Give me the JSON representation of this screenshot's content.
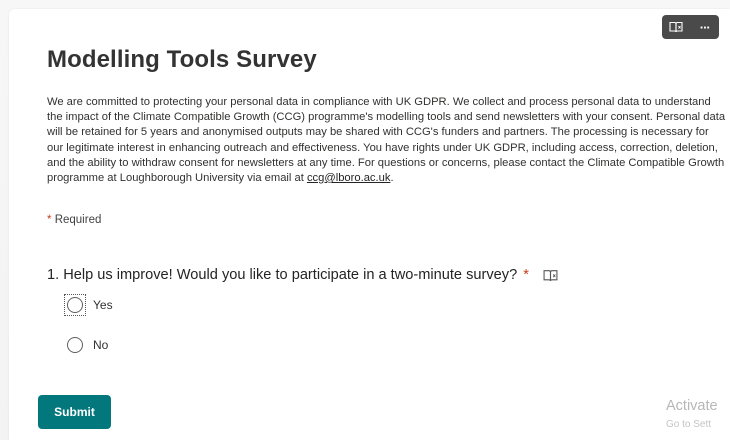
{
  "form": {
    "title": "Modelling Tools Survey",
    "description_parts": {
      "before_link": "We are committed to protecting your personal data in compliance with UK GDPR. We collect and process personal data to understand the impact of the Climate Compatible Growth (CCG) programme's modelling tools and send newsletters with your consent. Personal data will be retained for 5 years and anonymised outputs may be shared with CCG's funders and partners. The processing is necessary for our legitimate interest in enhancing outreach and effectiveness. You have rights under UK GDPR, including access, correction, deletion, and the ability to withdraw consent for newsletters at any time. For questions or concerns, please contact the Climate Compatible Growth programme at Loughborough University via email at ",
      "email_link": "ccg@lboro.ac.uk",
      "after_link": "."
    },
    "required_star": "*",
    "required_text": "Required",
    "question": {
      "number": "1.",
      "text": "Help us improve! Would you like to participate in a two-minute survey?",
      "required_star": "*",
      "options": [
        "Yes",
        "No"
      ],
      "selected": null
    },
    "submit_label": "Submit"
  },
  "toolbar": {
    "icons": [
      "immersive-reader-icon",
      "more-options-icon"
    ],
    "more_glyph": "···"
  },
  "watermark": {
    "title": "Activate",
    "subtitle": "Go to Sett"
  },
  "colors": {
    "accent": "#03787c",
    "required": "#c43e1c",
    "toolbar_bg": "#4a4a4a"
  }
}
